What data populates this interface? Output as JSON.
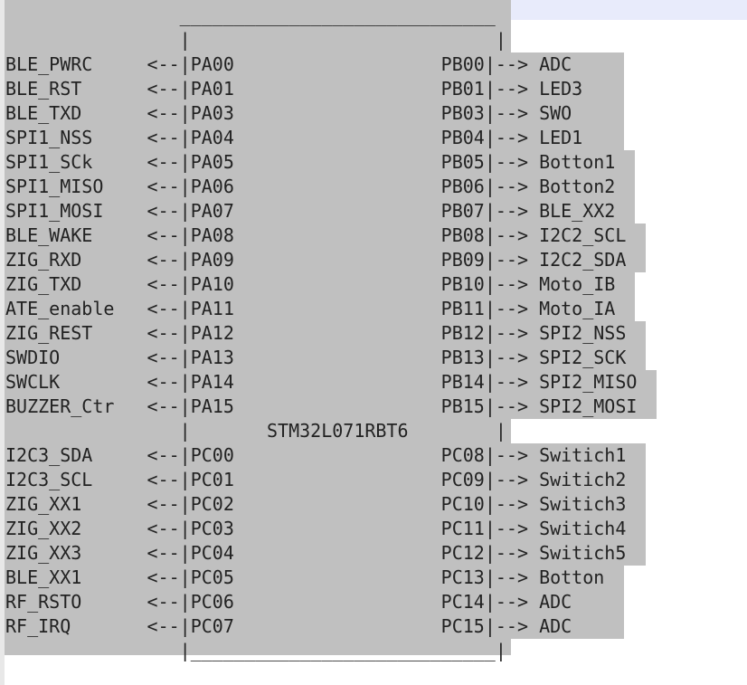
{
  "chip": {
    "name": "STM32L071RBT6",
    "left_arrow": "<--",
    "right_arrow": "-->"
  },
  "port_ab": [
    {
      "left_label": "BLE_PWRC",
      "left_pin": "PA00",
      "right_pin": "PB00",
      "right_label": "ADC"
    },
    {
      "left_label": "BLE_RST",
      "left_pin": "PA01",
      "right_pin": "PB01",
      "right_label": "LED3"
    },
    {
      "left_label": "BLE_TXD",
      "left_pin": "PA03",
      "right_pin": "PB03",
      "right_label": "SWO"
    },
    {
      "left_label": "SPI1_NSS",
      "left_pin": "PA04",
      "right_pin": "PB04",
      "right_label": "LED1"
    },
    {
      "left_label": "SPI1_SCk",
      "left_pin": "PA05",
      "right_pin": "PB05",
      "right_label": "Botton1"
    },
    {
      "left_label": "SPI1_MISO",
      "left_pin": "PA06",
      "right_pin": "PB06",
      "right_label": "Botton2"
    },
    {
      "left_label": "SPI1_MOSI",
      "left_pin": "PA07",
      "right_pin": "PB07",
      "right_label": "BLE_XX2"
    },
    {
      "left_label": "BLE_WAKE",
      "left_pin": "PA08",
      "right_pin": "PB08",
      "right_label": "I2C2_SCL"
    },
    {
      "left_label": "ZIG_RXD",
      "left_pin": "PA09",
      "right_pin": "PB09",
      "right_label": "I2C2_SDA"
    },
    {
      "left_label": "ZIG_TXD",
      "left_pin": "PA10",
      "right_pin": "PB10",
      "right_label": "Moto_IB"
    },
    {
      "left_label": "ATE_enable",
      "left_pin": "PA11",
      "right_pin": "PB11",
      "right_label": "Moto_IA"
    },
    {
      "left_label": "ZIG_REST",
      "left_pin": "PA12",
      "right_pin": "PB12",
      "right_label": "SPI2_NSS"
    },
    {
      "left_label": "SWDIO",
      "left_pin": "PA13",
      "right_pin": "PB13",
      "right_label": "SPI2_SCK"
    },
    {
      "left_label": "SWCLK",
      "left_pin": "PA14",
      "right_pin": "PB14",
      "right_label": "SPI2_MISO"
    },
    {
      "left_label": "BUZZER_Ctr",
      "left_pin": "PA15",
      "right_pin": "PB15",
      "right_label": "SPI2_MOSI"
    }
  ],
  "port_c": [
    {
      "left_label": "I2C3_SDA",
      "left_pin": "PC00",
      "right_pin": "PC08",
      "right_label": "Switich1"
    },
    {
      "left_label": "I2C3_SCL",
      "left_pin": "PC01",
      "right_pin": "PC09",
      "right_label": "Switich2"
    },
    {
      "left_label": "ZIG_XX1",
      "left_pin": "PC02",
      "right_pin": "PC10",
      "right_label": "Switich3"
    },
    {
      "left_label": "ZIG_XX2",
      "left_pin": "PC03",
      "right_pin": "PC11",
      "right_label": "Switich4"
    },
    {
      "left_label": "ZIG_XX3",
      "left_pin": "PC04",
      "right_pin": "PC12",
      "right_label": "Switich5"
    },
    {
      "left_label": "BLE_XX1",
      "left_pin": "PC05",
      "right_pin": "PC13",
      "right_label": "Botton"
    },
    {
      "left_label": "RF_RSTO",
      "left_pin": "PC06",
      "right_pin": "PC14",
      "right_label": "ADC"
    },
    {
      "left_label": "RF_IRQ",
      "left_pin": "PC07",
      "right_pin": "PC15",
      "right_label": "ADC"
    }
  ]
}
